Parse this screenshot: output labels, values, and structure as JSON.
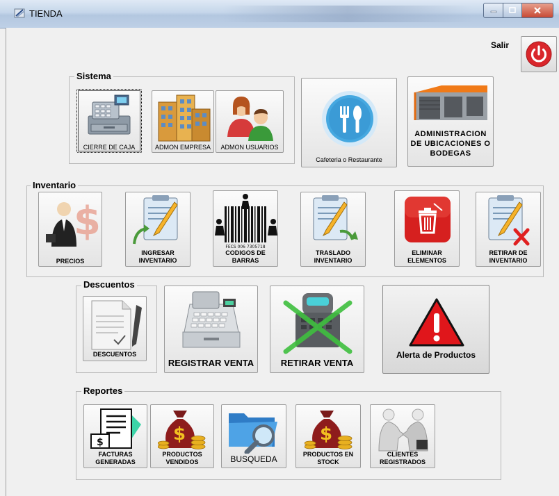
{
  "window": {
    "title": "TIENDA"
  },
  "header": {
    "salir_label": "Salir"
  },
  "groups": {
    "sistema": "Sistema",
    "inventario": "Inventario",
    "descuentos": "Descuentos",
    "reportes": "Reportes"
  },
  "sistema": {
    "cierre_caja": "CIERRE DE CAJA",
    "admon_empresa": "ADMON EMPRESA",
    "admon_usuarios": "ADMON USUARIOS",
    "cafeteria": "Cafeteria o Restaurante",
    "ubicaciones_l1": "ADMINISTRACION",
    "ubicaciones_l2": "DE UBICACIONES O",
    "ubicaciones_l3": "BODEGAS"
  },
  "inventario": {
    "precios": "PRECIOS",
    "ingresar_l1": "INGRESAR",
    "ingresar_l2": "INVENTARIO",
    "codigos_l1": "CODIGOS DE",
    "codigos_l2": "BARRAS",
    "codigos_icon_text": "FECS 006 7305718",
    "traslado_l1": "TRASLADO",
    "traslado_l2": "INVENTARIO",
    "eliminar_l1": "ELIMINAR",
    "eliminar_l2": "ELEMENTOS",
    "retirar_l1": "RETIRAR DE",
    "retirar_l2": "INVENTARIO"
  },
  "ventas": {
    "descuentos": "DESCUENTOS",
    "registrar_venta": "REGISTRAR VENTA",
    "retirar_venta": "RETIRAR VENTA",
    "alerta_productos": "Alerta de Productos"
  },
  "reportes": {
    "facturas_l1": "FACTURAS",
    "facturas_l2": "GENERADAS",
    "vendidos_l1": "PRODUCTOS",
    "vendidos_l2": "VENDIDOS",
    "busqueda": "BUSQUEDA",
    "stock_l1": "PRODUCTOS EN",
    "stock_l2": "STOCK",
    "clientes_l1": "CLIENTES",
    "clientes_l2": "REGISTRADOS"
  },
  "icons": {
    "power": "power-icon",
    "cash_register": "cash-register-icon",
    "buildings": "buildings-icon",
    "users": "users-icon",
    "cutlery": "cutlery-icon",
    "warehouse": "warehouse-icon",
    "businessman": "businessman-dollar-icon",
    "clipboard_in": "clipboard-add-icon",
    "barcode": "barcode-icon",
    "clipboard_move": "clipboard-move-icon",
    "trash": "trash-icon",
    "clipboard_x": "clipboard-remove-icon",
    "document_pen": "document-pen-icon",
    "register": "register-icon",
    "robot": "robot-icon",
    "warning": "warning-icon",
    "invoice": "invoice-icon",
    "money_bag": "money-bag-icon",
    "folder_search": "folder-search-icon",
    "handshake": "handshake-icon"
  },
  "colors": {
    "power_red": "#d9262b",
    "alert_red": "#e0161b",
    "title_blue": "#c5d6ea"
  }
}
